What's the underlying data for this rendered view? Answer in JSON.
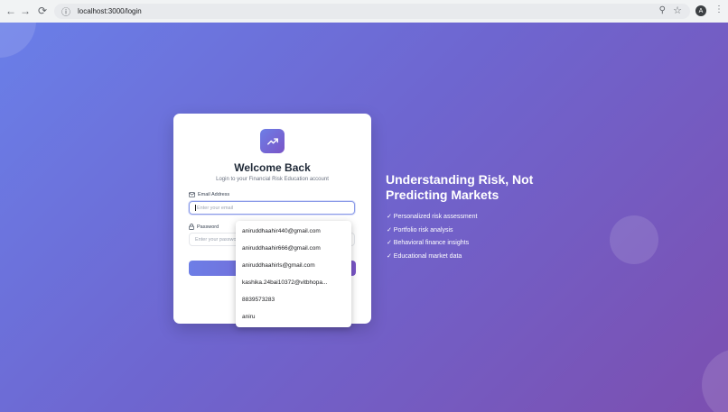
{
  "browser": {
    "url": "localhost:3000/login",
    "back_icon": "←",
    "forward_icon": "→",
    "reload_icon": "⟳",
    "info_icon": "ⓘ",
    "zoom_icon": "⚲",
    "star_icon": "☆",
    "profile_initial": "A",
    "menu_icon": "⋮"
  },
  "login": {
    "title": "Welcome Back",
    "subtitle": "Login to your Financial Risk Education account",
    "email_label": "Email Address",
    "email_placeholder": "Enter your email",
    "password_label": "Password",
    "password_placeholder": "Enter your password"
  },
  "autofill": [
    "aniruddhaahir440@gmail.com",
    "aniruddhaahir666@gmail.com",
    "aniruddhaahirls@gmail.com",
    "kashika.24bai10372@vitbhopa...",
    "8839573283",
    "aniru"
  ],
  "promo": {
    "headline": "Understanding Risk, Not Predicting Markets",
    "features": [
      "✓ Personalized risk assessment",
      "✓ Portfolio risk analysis",
      "✓ Behavioral finance insights",
      "✓ Educational market data"
    ]
  },
  "colors": {
    "gradient_start": "#6a7fe8",
    "gradient_end": "#7c4fb0",
    "accent": "#7a55c7"
  }
}
